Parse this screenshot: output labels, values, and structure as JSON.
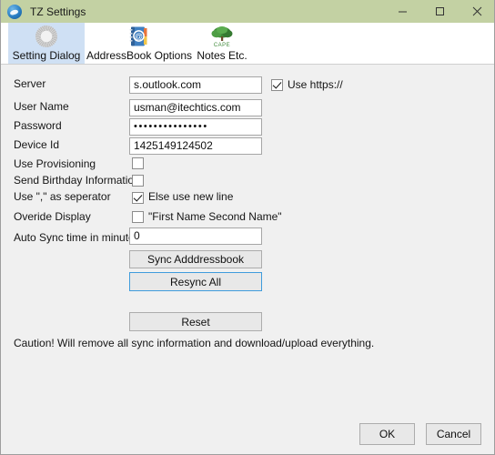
{
  "window": {
    "title": "TZ Settings",
    "app_icon": "app-globe-icon",
    "titlebar_color": "#c3d1a3",
    "controls": [
      {
        "name": "minimize",
        "glyph": "minimize-icon"
      },
      {
        "name": "maximize",
        "glyph": "maximize-icon"
      },
      {
        "name": "close",
        "glyph": "close-icon"
      }
    ]
  },
  "tabs": [
    {
      "label": "Setting Dialog",
      "icon": "gear-icon",
      "selected": true
    },
    {
      "label": "AddressBook Options",
      "icon": "addressbook-at-icon",
      "selected": false
    },
    {
      "label": "Notes Etc.",
      "icon": "tree-cape-icon",
      "selected": false
    }
  ],
  "form": {
    "fields": [
      {
        "label": "Server",
        "value": "s.outlook.com"
      },
      {
        "label": "User Name",
        "value": "usman@itechtics.com"
      },
      {
        "label": "Password",
        "value": "•••••••••••••••"
      },
      {
        "label": "Device Id",
        "value": "1425149124502"
      }
    ],
    "https_checkbox": {
      "label": "Use https://",
      "checked": true
    },
    "checkboxes": [
      {
        "label": "Use Provisioning",
        "checked": false,
        "side_label": ""
      },
      {
        "label": "Send Birthday Information",
        "checked": false,
        "side_label": ""
      },
      {
        "label": "Use \",\" as seperator",
        "checked": true,
        "side_label": "Else use new line"
      },
      {
        "label": "Overide Display",
        "checked": false,
        "side_label": "\"First Name Second Name\""
      }
    ],
    "auto_sync": {
      "label": "Auto Sync time in minutes",
      "value": "0"
    }
  },
  "buttons": {
    "sync_addressbook": "Sync Adddressbook",
    "resync_all": "Resync All",
    "reset": "Reset",
    "ok": "OK",
    "cancel": "Cancel"
  },
  "caution": "Caution! Will remove all sync information and download/upload everything."
}
